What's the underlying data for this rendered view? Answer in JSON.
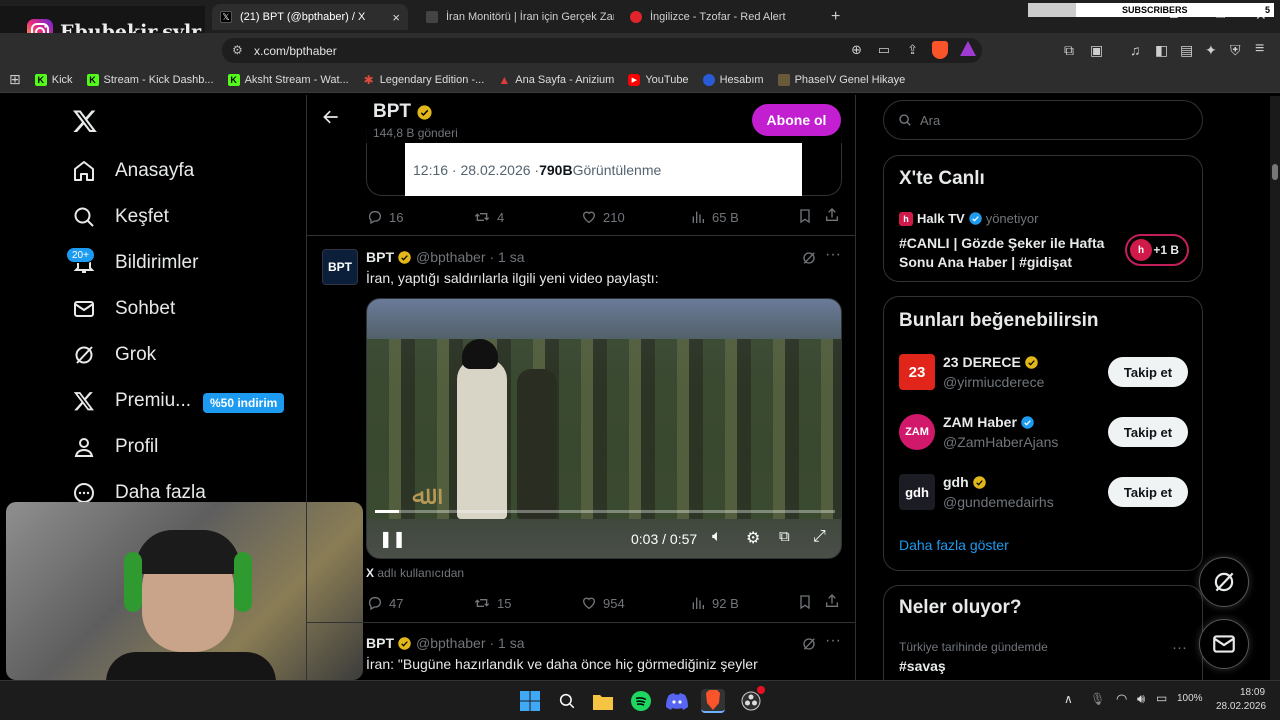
{
  "overlay": {
    "instagram_handle": "Ebubekir.sylr",
    "subscribers_label": "SUBSCRIBERS",
    "subscribers_count": "5"
  },
  "tabs": [
    {
      "title": "(21) BPT (@bpthaber) / X",
      "active": true
    },
    {
      "title": "İran Monitörü | İran için Gerçek Zama...",
      "active": false
    },
    {
      "title": "İngilizce - Tzofar - Red Alert",
      "active": false
    }
  ],
  "address": {
    "url": "x.com/bpthaber"
  },
  "bookmarks": [
    {
      "label": "Kick",
      "icon": "kick-icon"
    },
    {
      "label": "Stream - Kick Dashb...",
      "icon": "kick-icon"
    },
    {
      "label": "Aksht Stream - Wat...",
      "icon": "kick-icon"
    },
    {
      "label": "Legendary Edition -...",
      "icon": "star-icon"
    },
    {
      "label": "Ana Sayfa - Anizium",
      "icon": "anizium-icon"
    },
    {
      "label": "YouTube",
      "icon": "youtube-icon"
    },
    {
      "label": "Hesabım",
      "icon": "account-icon"
    },
    {
      "label": "PhaseIV Genel Hikaye",
      "icon": "phase-icon"
    }
  ],
  "nav": {
    "items": [
      {
        "label": "Anasayfa",
        "icon": "home-icon"
      },
      {
        "label": "Keşfet",
        "icon": "search-icon"
      },
      {
        "label": "Bildirimler",
        "icon": "bell-icon",
        "badge": "20+"
      },
      {
        "label": "Sohbet",
        "icon": "mail-icon"
      },
      {
        "label": "Grok",
        "icon": "grok-icon"
      },
      {
        "label": "Premiu...",
        "icon": "x-icon",
        "badge": "%50 indirim"
      },
      {
        "label": "Profil",
        "icon": "person-icon"
      },
      {
        "label": "Daha fazla",
        "icon": "more-icon"
      }
    ]
  },
  "header": {
    "name": "BPT",
    "subtitle": "144,8 B gönderi",
    "subscribe_label": "Abone ol"
  },
  "post0": {
    "time": "12:16 · 28.02.2026 · ",
    "views_value": "790B",
    "views_label": " Görüntülenme",
    "replies": "16",
    "reposts": "4",
    "likes": "210",
    "views": "65 B"
  },
  "post1": {
    "name": "BPT",
    "handle": "@bpthaber",
    "time": "· 1 sa",
    "text": "İran, yaptığı saldırılarla ilgili yeni video paylaştı:",
    "video_time": "0:03 / 0:57",
    "video_progress": 0.053,
    "source": "adlı kullanıcıdan",
    "source_x": "X",
    "replies": "47",
    "reposts": "15",
    "likes": "954",
    "views": "92 B"
  },
  "post2": {
    "name": "BPT",
    "handle": "@bpthaber",
    "time": "· 1 sa",
    "text": "İran: \"Bugüne hazırlandık ve daha önce hiç görmediğiniz şeyler"
  },
  "search": {
    "placeholder": "Ara"
  },
  "live": {
    "title": "X'te Canlı",
    "host": "Halk TV",
    "host_suffix": "yönetiyor",
    "headline": "#CANLI | Gözde Şeker ile Hafta Sonu Ana Haber | #gidişat",
    "listeners": "+1 B"
  },
  "suggestions": {
    "title": "Bunları beğenebilirsin",
    "follow_label": "Takip et",
    "show_more": "Daha fazla göster",
    "items": [
      {
        "name": "23 DERECE",
        "handle": "@yirmiucderece",
        "avatar_text": "23",
        "badge": "gold"
      },
      {
        "name": "ZAM Haber",
        "handle": "@ZamHaberAjans",
        "avatar_text": "ZAM",
        "badge": "blue"
      },
      {
        "name": "gdh",
        "handle": "@gundemedairhs",
        "avatar_text": "gdh",
        "badge": "gold"
      }
    ]
  },
  "trends": {
    "title": "Neler oluyor?",
    "context": "Türkiye tarihinde gündemde",
    "topic": "#savaş"
  },
  "taskbar": {
    "time": "18:09",
    "date": "28.02.2026",
    "battery": "100%"
  },
  "colors": {
    "accent": "#1d9bf0",
    "subscribe": "#c21fd1",
    "gold": "#e2b719"
  }
}
